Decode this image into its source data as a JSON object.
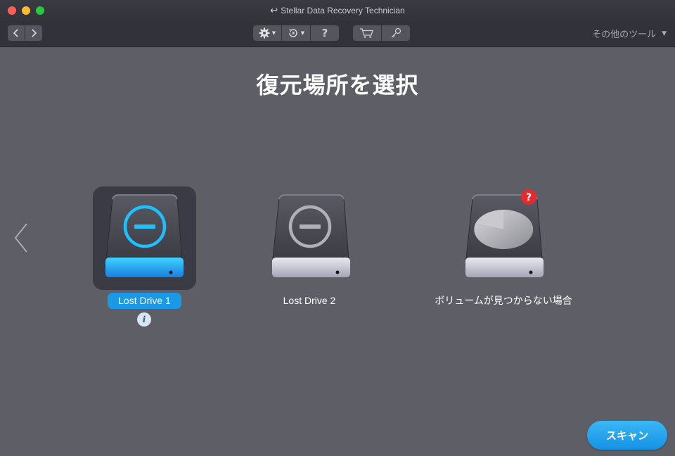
{
  "window": {
    "title": "Stellar Data Recovery Technician"
  },
  "toolbar": {
    "help_label": "?",
    "other_tools_label": "その他のツール",
    "other_tools_arrow": "▼",
    "icons": [
      "chevron-left-icon",
      "chevron-right-icon",
      "gear-icon",
      "history-icon",
      "help-icon",
      "cart-icon",
      "key-icon"
    ]
  },
  "main": {
    "page_title": "復元場所を選択",
    "drives": [
      {
        "label": "Lost Drive 1",
        "selected": true,
        "icon": "lost-drive-icon"
      },
      {
        "label": "Lost Drive 2",
        "selected": false,
        "icon": "lost-drive-icon"
      },
      {
        "label": "ボリュームが見つからない場合",
        "selected": false,
        "icon": "missing-volume-icon"
      }
    ],
    "info_glyph": "i",
    "question_glyph": "?",
    "scan_label": "スキャン"
  },
  "colors": {
    "background": "#5e5e67",
    "toolbar": "#32323a",
    "accent": "#1b98e6",
    "selected_drive_glow": "#1ec0ff",
    "alert_badge": "#e8292e"
  }
}
